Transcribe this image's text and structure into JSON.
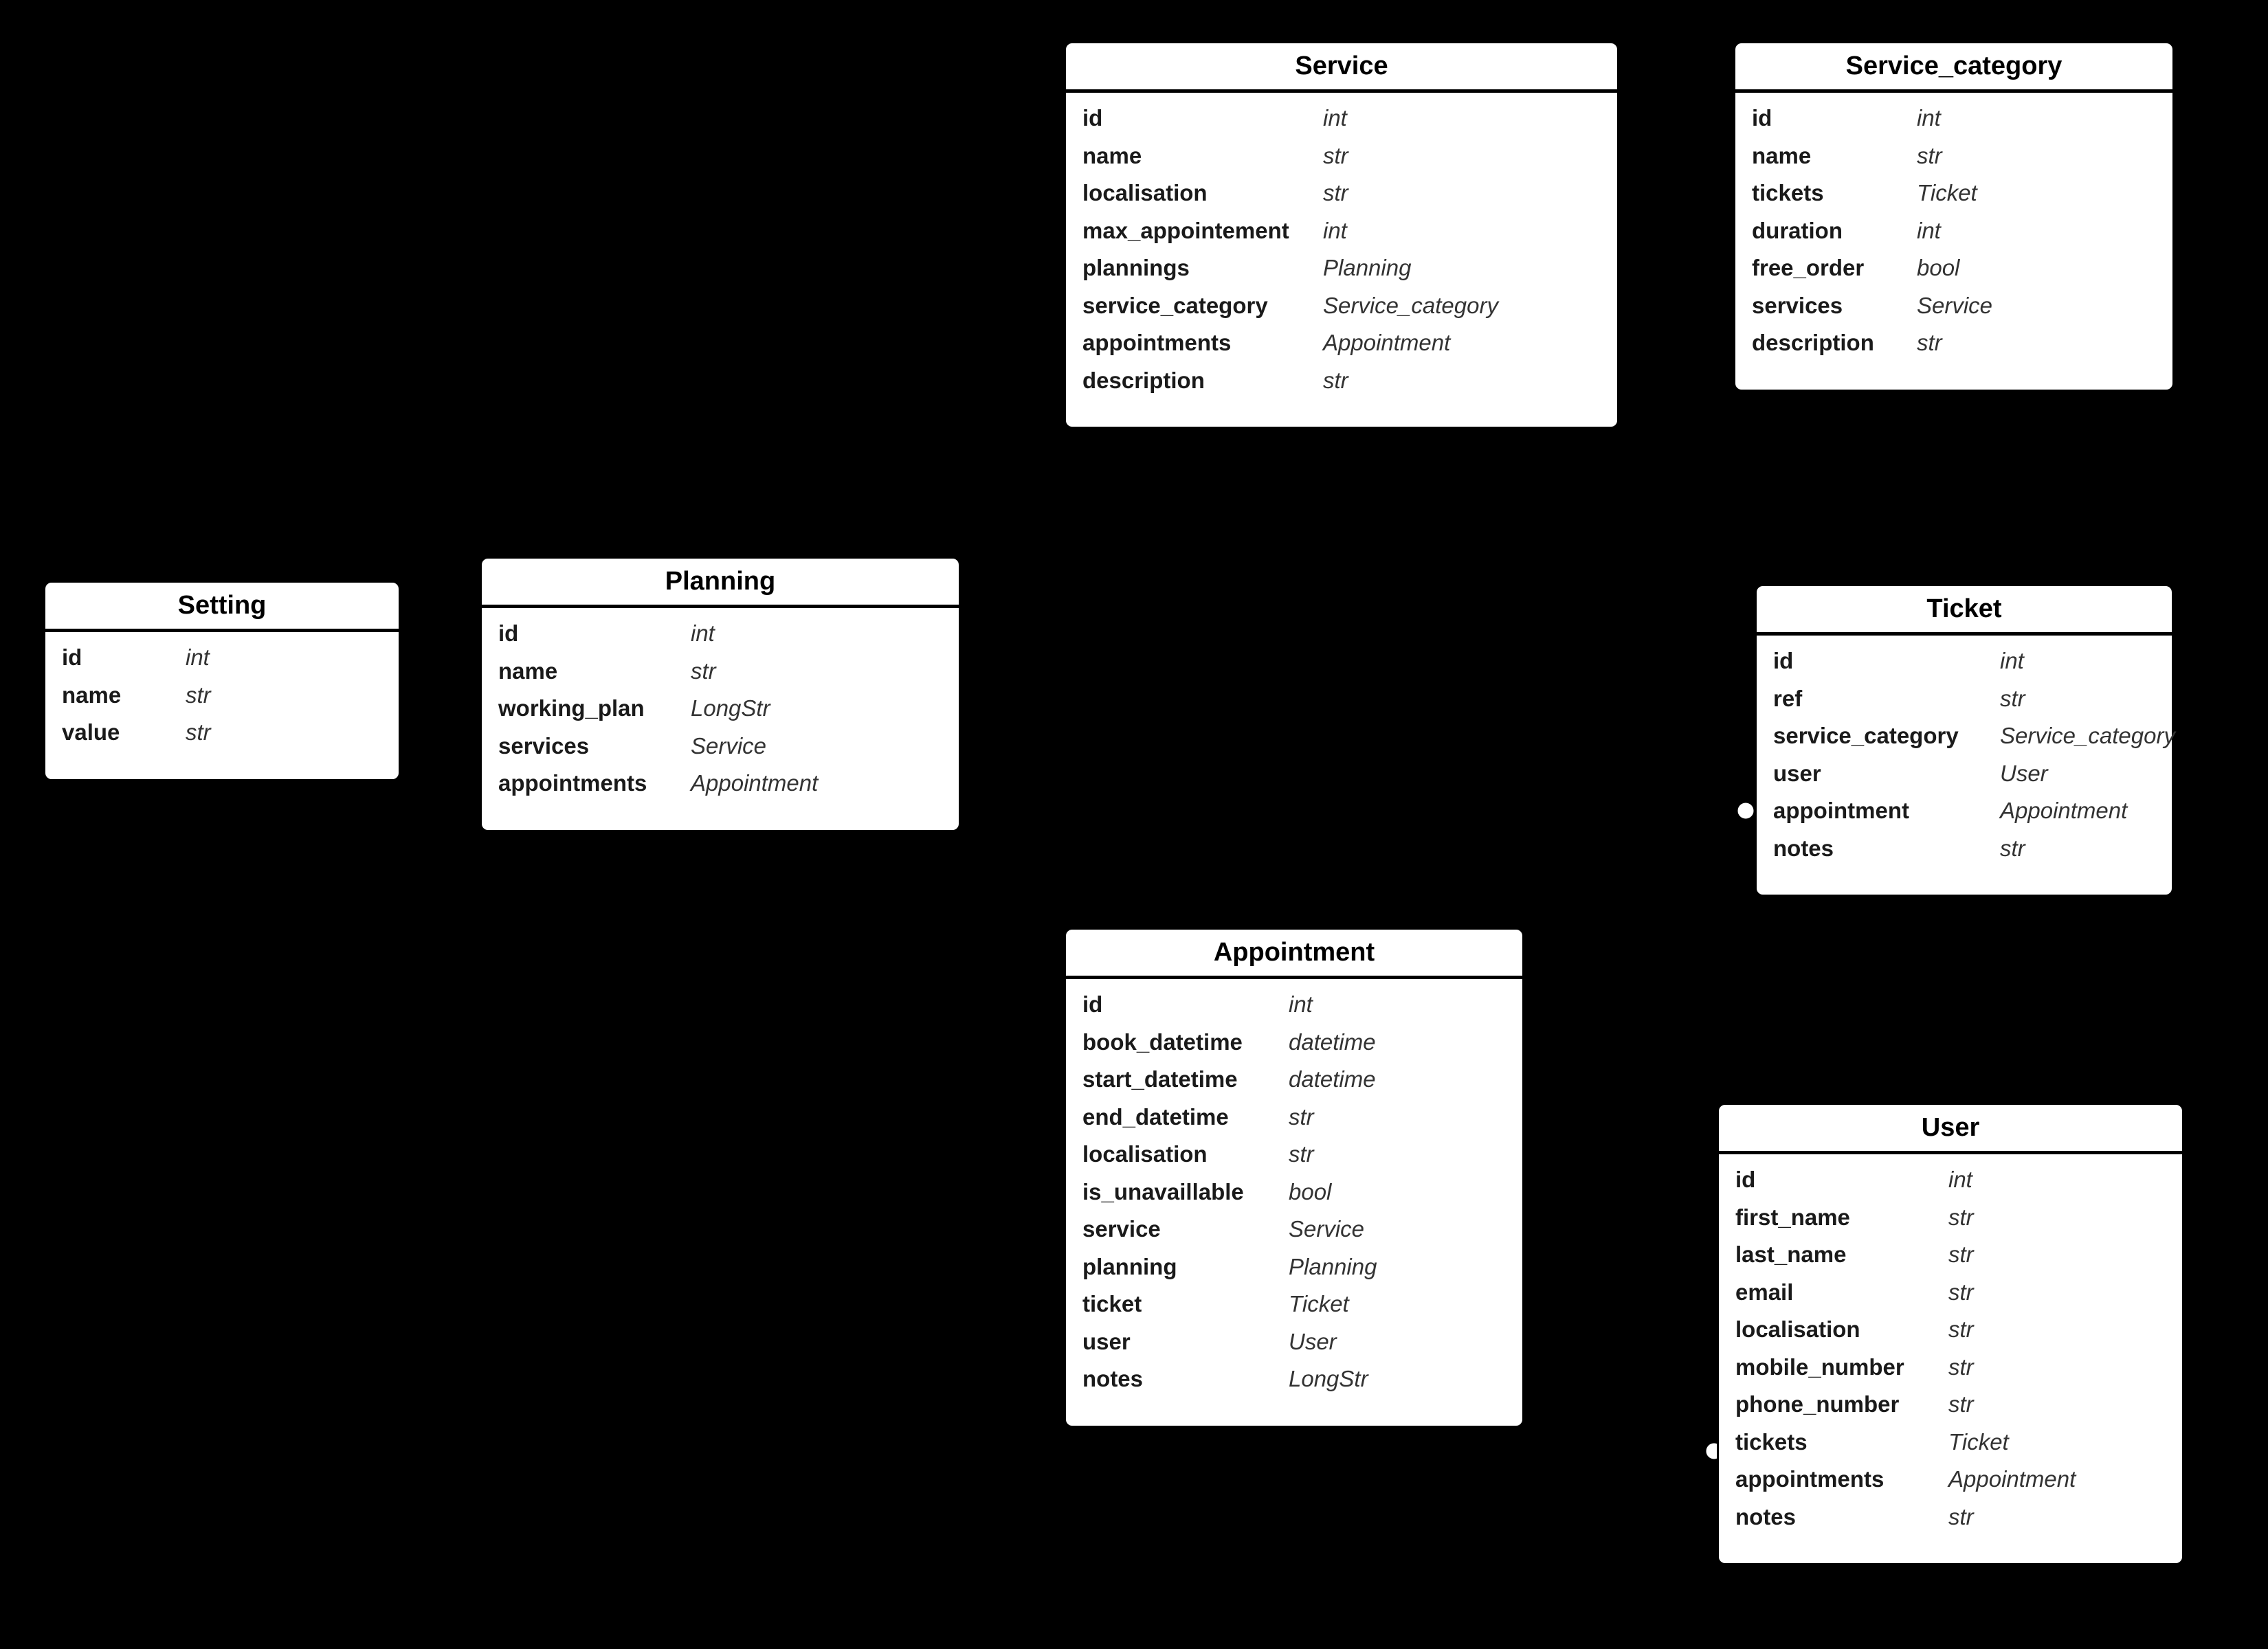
{
  "entities": {
    "setting": {
      "title": "Setting",
      "fields": [
        {
          "name": "id",
          "type": "int"
        },
        {
          "name": "name",
          "type": "str"
        },
        {
          "name": "value",
          "type": "str"
        }
      ]
    },
    "planning": {
      "title": "Planning",
      "fields": [
        {
          "name": "id",
          "type": "int"
        },
        {
          "name": "name",
          "type": "str"
        },
        {
          "name": "working_plan",
          "type": "LongStr"
        },
        {
          "name": "services",
          "type": "Service"
        },
        {
          "name": "appointments",
          "type": "Appointment"
        }
      ]
    },
    "service": {
      "title": "Service",
      "fields": [
        {
          "name": "id",
          "type": "int"
        },
        {
          "name": "name",
          "type": "str"
        },
        {
          "name": "localisation",
          "type": "str"
        },
        {
          "name": "max_appointement",
          "type": "int"
        },
        {
          "name": "plannings",
          "type": "Planning"
        },
        {
          "name": "service_category",
          "type": "Service_category"
        },
        {
          "name": "appointments",
          "type": "Appointment"
        },
        {
          "name": "description",
          "type": "str"
        }
      ]
    },
    "service_category": {
      "title": "Service_category",
      "fields": [
        {
          "name": "id",
          "type": "int"
        },
        {
          "name": "name",
          "type": "str"
        },
        {
          "name": "tickets",
          "type": "Ticket"
        },
        {
          "name": "duration",
          "type": "int"
        },
        {
          "name": "free_order",
          "type": "bool"
        },
        {
          "name": "services",
          "type": "Service"
        },
        {
          "name": "description",
          "type": "str"
        }
      ]
    },
    "ticket": {
      "title": "Ticket",
      "fields": [
        {
          "name": "id",
          "type": "int"
        },
        {
          "name": "ref",
          "type": "str"
        },
        {
          "name": "service_category",
          "type": "Service_category"
        },
        {
          "name": "user",
          "type": "User"
        },
        {
          "name": "appointment",
          "type": "Appointment"
        },
        {
          "name": "notes",
          "type": "str"
        }
      ]
    },
    "appointment": {
      "title": "Appointment",
      "fields": [
        {
          "name": "id",
          "type": "int"
        },
        {
          "name": "book_datetime",
          "type": "datetime"
        },
        {
          "name": "start_datetime",
          "type": "datetime"
        },
        {
          "name": "end_datetime",
          "type": "str"
        },
        {
          "name": "localisation",
          "type": "str"
        },
        {
          "name": "is_unavaillable",
          "type": "bool"
        },
        {
          "name": "service",
          "type": "Service"
        },
        {
          "name": "planning",
          "type": "Planning"
        },
        {
          "name": "ticket",
          "type": "Ticket"
        },
        {
          "name": "user",
          "type": "User"
        },
        {
          "name": "notes",
          "type": "LongStr"
        }
      ]
    },
    "user": {
      "title": "User",
      "fields": [
        {
          "name": "id",
          "type": "int"
        },
        {
          "name": "first_name",
          "type": "str"
        },
        {
          "name": "last_name",
          "type": "str"
        },
        {
          "name": "email",
          "type": "str"
        },
        {
          "name": "localisation",
          "type": "str"
        },
        {
          "name": "mobile_number",
          "type": "str"
        },
        {
          "name": "phone_number",
          "type": "str"
        },
        {
          "name": "tickets",
          "type": "Ticket"
        },
        {
          "name": "appointments",
          "type": "Appointment"
        },
        {
          "name": "notes",
          "type": "str"
        }
      ]
    }
  }
}
